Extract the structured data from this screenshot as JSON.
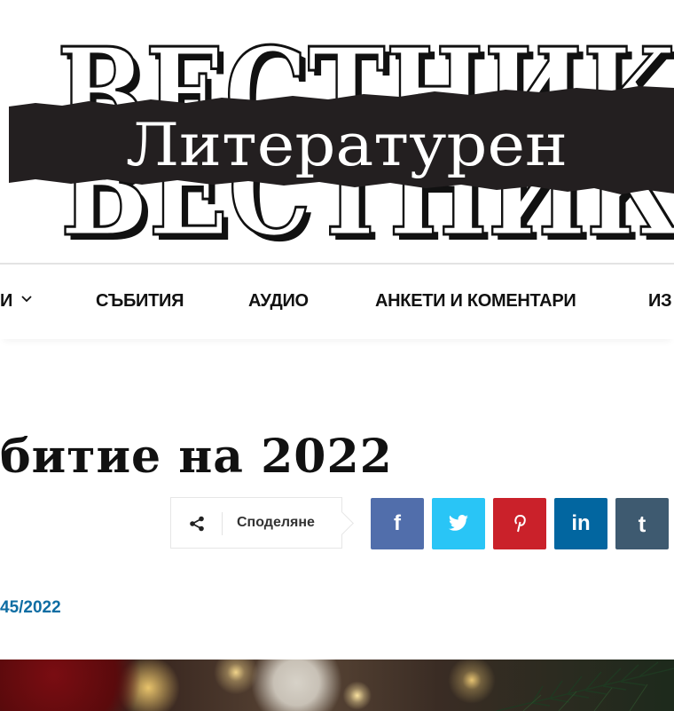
{
  "logo": {
    "top_word": "ВЕСТНИК",
    "band_word": "Литературен",
    "bottom_word": "ВЕСТНИК"
  },
  "nav": {
    "items": [
      {
        "label": "И",
        "has_dropdown": true
      },
      {
        "label": "СЪБИТИЯ"
      },
      {
        "label": "АУДИО"
      },
      {
        "label": "АНКЕТИ И КОМЕНТАРИ"
      },
      {
        "label": "ИЗ"
      }
    ]
  },
  "article": {
    "title": "битие на 2022",
    "issue_link": "45/2022"
  },
  "share": {
    "label": "Споделяне",
    "icon": "share-icon",
    "networks": [
      {
        "name": "facebook",
        "icon": "facebook-icon",
        "glyph": "f",
        "color": "#516eab"
      },
      {
        "name": "twitter",
        "icon": "twitter-icon",
        "glyph": "",
        "color": "#29c5f6"
      },
      {
        "name": "pinterest",
        "icon": "pinterest-icon",
        "glyph": "",
        "color": "#ca212a"
      },
      {
        "name": "linkedin",
        "icon": "linkedin-icon",
        "glyph": "in",
        "color": "#0266a0"
      },
      {
        "name": "tumblr",
        "icon": "tumblr-icon",
        "glyph": "t",
        "color": "#3e5a70"
      }
    ]
  },
  "colors": {
    "link": "#0e6da3",
    "band": "#231f20"
  }
}
